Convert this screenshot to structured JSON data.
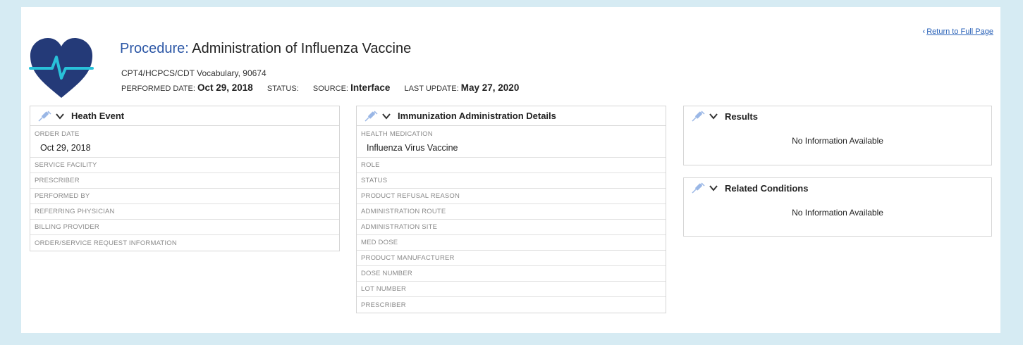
{
  "header": {
    "return_link": "Return to Full Page",
    "title_label": "Procedure:",
    "title_value": "Administration of Influenza Vaccine",
    "vocabulary": "CPT4/HCPCS/CDT Vocabulary, 90674",
    "performed_date_label": "PERFORMED DATE:",
    "performed_date": "Oct 29, 2018",
    "status_label": "STATUS:",
    "status_value": "",
    "source_label": "SOURCE:",
    "source_value": "Interface",
    "last_update_label": "LAST UPDATE:",
    "last_update": "May 27, 2020",
    "logo_icon": "heart-pulse-icon",
    "logo_color": "#243a78",
    "pulse_color": "#29c1d9"
  },
  "health_event": {
    "title": "Heath Event",
    "order_date_label": "ORDER DATE",
    "order_date_value": "Oct 29, 2018",
    "rows": [
      "SERVICE FACILITY",
      "PRESCRIBER",
      "PERFORMED BY",
      "REFERRING PHYSICIAN",
      "BILLING PROVIDER",
      "ORDER/SERVICE REQUEST INFORMATION"
    ]
  },
  "immunization": {
    "title": "Immunization Administration Details",
    "medication_label": "HEALTH MEDICATION",
    "medication_value": "Influenza Virus Vaccine",
    "rows": [
      "ROLE",
      "STATUS",
      "PRODUCT REFUSAL REASON",
      "ADMINISTRATION ROUTE",
      "ADMINISTRATION SITE",
      "MED DOSE",
      "PRODUCT MANUFACTURER",
      "DOSE NUMBER",
      "LOT NUMBER",
      "PRESCRIBER"
    ]
  },
  "results": {
    "title": "Results",
    "empty_text": "No Information Available"
  },
  "related_conditions": {
    "title": "Related Conditions",
    "empty_text": "No Information Available"
  },
  "icons": {
    "panel_icon": "syringe-icon",
    "collapse_icon": "chevron-down-icon",
    "syringe_color": "#9ab7e6",
    "accent_link": "#2a62b8"
  }
}
